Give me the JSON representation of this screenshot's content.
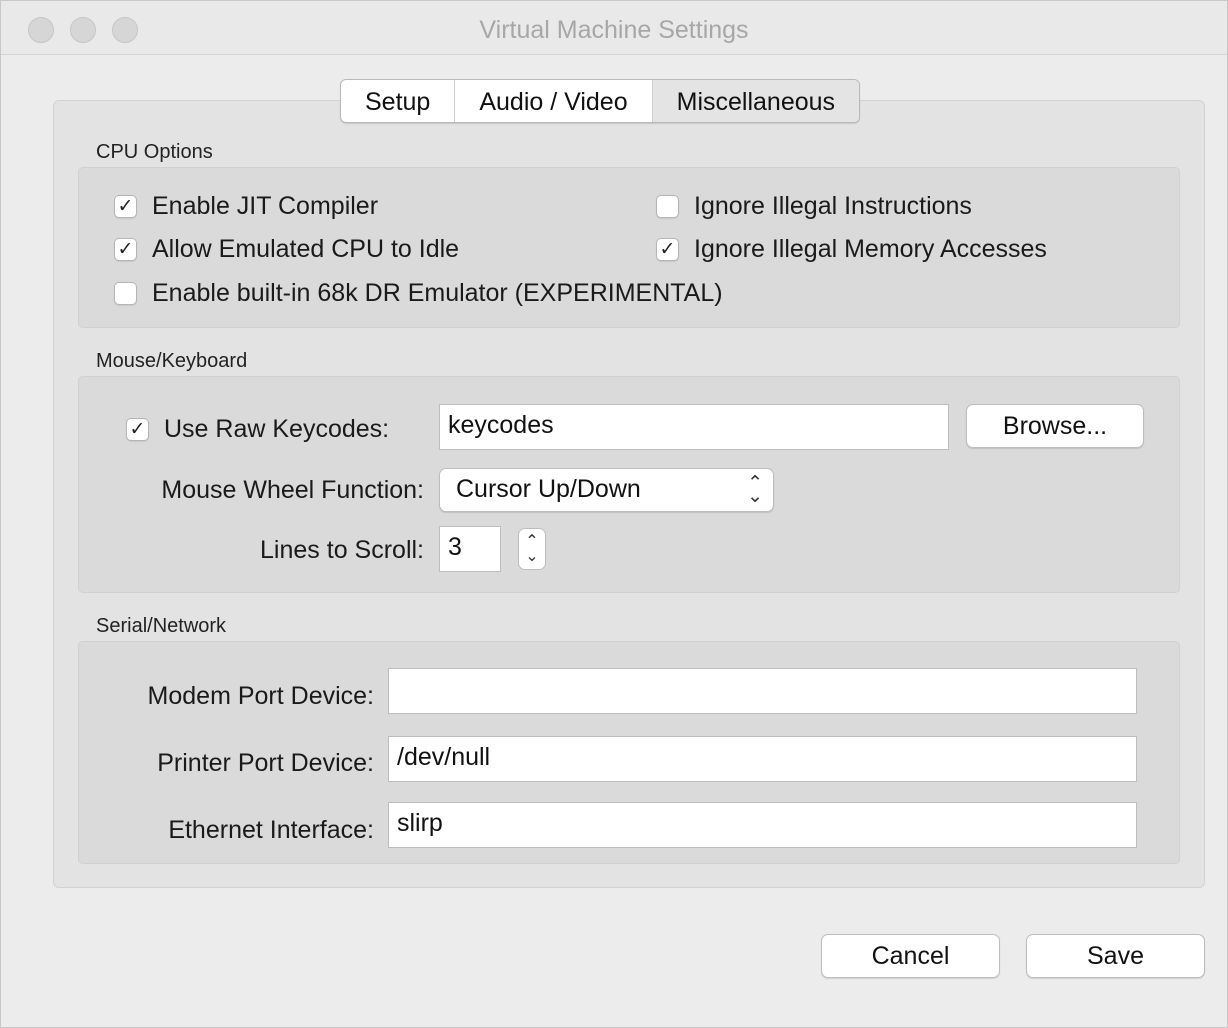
{
  "window": {
    "title": "Virtual Machine Settings"
  },
  "tabs": [
    {
      "label": "Setup"
    },
    {
      "label": "Audio / Video"
    },
    {
      "label": "Miscellaneous"
    }
  ],
  "selected_tab": "Miscellaneous",
  "cpu": {
    "section": "CPU Options",
    "options": [
      {
        "label": "Enable JIT Compiler",
        "checked": true,
        "mark": "✓"
      },
      {
        "label": "Allow Emulated CPU to Idle",
        "checked": true,
        "mark": "✓"
      },
      {
        "label": "Enable built-in 68k DR Emulator (EXPERIMENTAL)",
        "checked": false,
        "mark": ""
      },
      {
        "label": "Ignore Illegal Instructions",
        "checked": false,
        "mark": ""
      },
      {
        "label": "Ignore Illegal Memory Accesses",
        "checked": true,
        "mark": "✓"
      }
    ]
  },
  "mouse": {
    "section": "Mouse/Keyboard",
    "raw_keycodes": {
      "label": "Use Raw Keycodes:",
      "checked": true,
      "mark": "✓",
      "value": "keycodes"
    },
    "browse_label": "Browse...",
    "wheel": {
      "label": "Mouse Wheel Function:",
      "value": "Cursor Up/Down"
    },
    "lines": {
      "label": "Lines to Scroll:",
      "value": "3"
    }
  },
  "serial": {
    "section": "Serial/Network",
    "modem": {
      "label": "Modem Port Device:",
      "value": ""
    },
    "printer": {
      "label": "Printer Port Device:",
      "value": "/dev/null"
    },
    "ethernet": {
      "label": "Ethernet Interface:",
      "value": "slirp"
    }
  },
  "footer": {
    "cancel_label": "Cancel",
    "save_label": "Save"
  },
  "colors": {
    "window_bg": "#ececec",
    "group_bg": "#dadada",
    "panel_bg": "#e3e3e3"
  },
  "icons": {
    "close": "traffic-light-close",
    "minimize": "traffic-light-minimize",
    "zoom": "traffic-light-zoom"
  }
}
